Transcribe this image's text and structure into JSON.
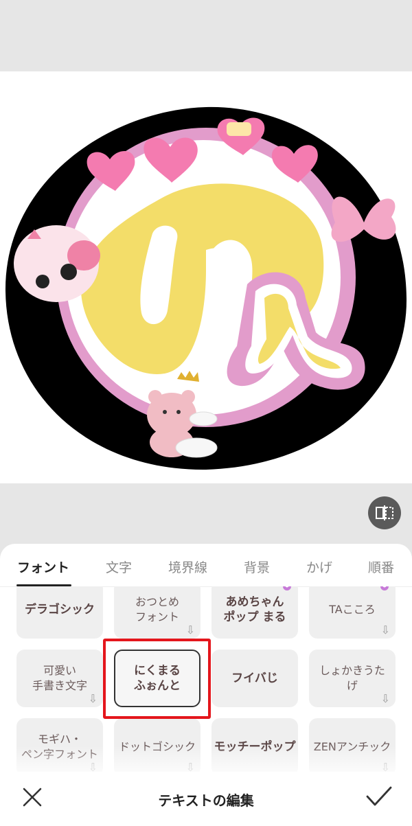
{
  "editor": {
    "big_letter": "り",
    "small_letter": "ん"
  },
  "tabs": [
    {
      "label": "フォント"
    },
    {
      "label": "文字"
    },
    {
      "label": "境界線"
    },
    {
      "label": "背景"
    },
    {
      "label": "かげ"
    },
    {
      "label": "順番"
    }
  ],
  "fonts": [
    {
      "label": "デラゴシック"
    },
    {
      "label": "おつとめ\nフォント"
    },
    {
      "label": "あめちゃん\nポップ まる"
    },
    {
      "label": "TAこころ"
    },
    {
      "label": "可愛い\n手書き文字"
    },
    {
      "label": "にくまる\nふぉんと"
    },
    {
      "label": "フイバじ"
    },
    {
      "label": "しょかきうた\nげ"
    },
    {
      "label": "モギハ・\nペン字フォント"
    },
    {
      "label": "ドットゴシック"
    },
    {
      "label": "モッチーポップ"
    },
    {
      "label": "ZENアンチック"
    }
  ],
  "icons": {
    "download": "download-arrow-icon",
    "compare": "compare-icon",
    "close": "close-icon",
    "confirm": "check-icon"
  },
  "colors": {
    "accent_pink": "#e29ccb",
    "yellow": "#f3dd69",
    "highlight_red": "#e4161c"
  },
  "bottom_bar": {
    "title": "テキストの編集"
  }
}
